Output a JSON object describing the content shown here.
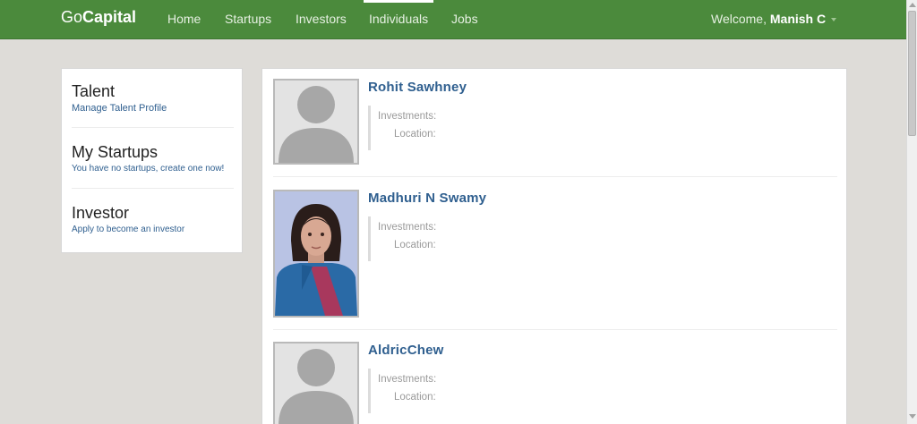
{
  "nav": {
    "brand_prefix": "Go",
    "brand_suffix": "Capital",
    "items": [
      {
        "label": "Home"
      },
      {
        "label": "Startups"
      },
      {
        "label": "Investors"
      },
      {
        "label": "Individuals",
        "active": true
      },
      {
        "label": "Jobs"
      }
    ],
    "welcome_prefix": "Welcome, ",
    "user_name": "Manish C"
  },
  "sidebar": {
    "talent": {
      "title": "Talent",
      "link": "Manage Talent Profile"
    },
    "startups": {
      "title": "My Startups",
      "text": "You have no startups, ",
      "link": "create one now!"
    },
    "investor": {
      "title": "Investor",
      "link": "Apply to become an investor"
    }
  },
  "people": [
    {
      "name": "Rohit Sawhney",
      "investments_label": "Investments:",
      "location_label": "Location:",
      "photo": "default-avatar"
    },
    {
      "name": "Madhuri N Swamy",
      "investments_label": "Investments:",
      "location_label": "Location:",
      "photo": "profile-photo"
    },
    {
      "name": "AldricChew",
      "investments_label": "Investments:",
      "location_label": "Location:",
      "photo": "default-avatar"
    }
  ],
  "colors": {
    "navbar": "#4b8a3c",
    "link": "#2f5f8f",
    "page_bg": "#dedcd8"
  }
}
